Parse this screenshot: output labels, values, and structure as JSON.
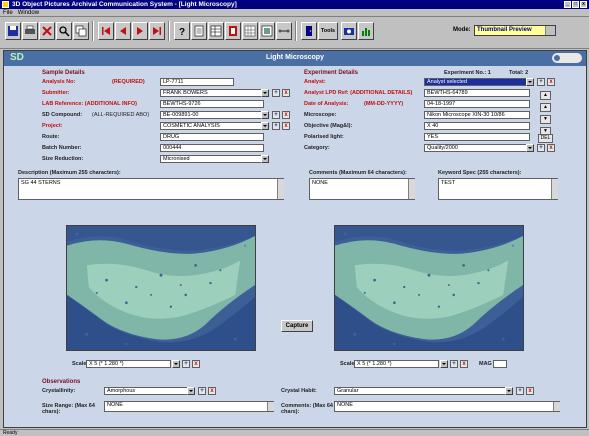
{
  "window": {
    "title": "3D Object Pictures Archival Communication System - [Light Microscopy]",
    "controls": [
      "_",
      "□",
      "x"
    ]
  },
  "menubar": {
    "items": [
      "File",
      "Window"
    ]
  },
  "toolbar": {
    "user_label": "Mode:",
    "mode_value": "Thumbnail Preview",
    "flash_label": "Tools"
  },
  "form": {
    "app_badge": "SD",
    "title": "Light Microscopy",
    "sample": {
      "section": "Sample Details",
      "analysis_no_label": "Analysis No:",
      "analysis_no_hint": "(REQUIRED)",
      "analysis_no_value": "LP-7711",
      "submitter_label": "Submitter:",
      "submitter_value": "FRANK BOWERS",
      "lab_reference_label": "LAB Reference: (ADDITIONAL INFO)",
      "lab_reference_value": "BEWTHS-9726",
      "sd_compound_label": "SD Compound:",
      "sd_compound_hint": "(ALL-REQUIRED ABO)",
      "sd_compound_value": "BE-009891-00",
      "project_label": "Project:",
      "project_value": "COSMETIC ANALYSIS",
      "route_label": "Route:",
      "route_value": "DRUG",
      "batch_label": "Batch Number:",
      "batch_value": "000444",
      "size_label": "Size Reduction:",
      "size_value": "Micronised"
    },
    "experiment": {
      "section": "Experiment Details",
      "number_label": "Experiment No.: 1",
      "total_label": "Total: 2",
      "analyst_label": "Analyst:",
      "analyst_value": "Analyst selected",
      "analysis_label": "Analyst LPD Ref: (ADDITIONAL DETAILS)",
      "analysis_value": "BEWTHS-64789",
      "date_label": "Date of Analysis:",
      "date_hint": "(MM-DD-YYYY)",
      "date_value": "04-18-1997",
      "microscope_label": "Microscope:",
      "microscope_value": "Nikon Microscope XIN-30 10/86",
      "objective_label": "Objective (Mag&l):",
      "objective_value": "X 40",
      "polarised_label": "Polarised light:",
      "polarised_value": "YES",
      "category_label": "Category:",
      "category_value": "Quality/2000"
    },
    "side_buttons": [
      "▲",
      "▲",
      "▼",
      "▼",
      "DEL"
    ],
    "description": {
      "label": "Description (Maximum 255 characters):",
      "value": "SG 44 STERNS"
    },
    "comments": {
      "label": "Comments (Maximum 64 characters):",
      "value": "NONE"
    },
    "keyword": {
      "label": "Keyword Spec (255 characters):",
      "value": "TEST"
    },
    "capture_button": "Capture",
    "left_image": {
      "scale_label": "Scale:",
      "scale_value": "X 5 (* 1.280 *)"
    },
    "right_image": {
      "scale_label": "Scale:",
      "scale_value": "X 5 (* 1.280 *)",
      "mag_label": "MAG"
    },
    "observations": {
      "section": "Observations",
      "crystallinity_label": "Crystallinity:",
      "crystallinity_value": "Amorphous",
      "size_range_label": "Size Range: (Max 64 chars):",
      "size_range_value": "NONE",
      "crystal_habit_label": "Crystal Habit:",
      "crystal_habit_value": "Granular",
      "comments_label": "Comments: (Max 64 chars):",
      "comments_value": "NONE"
    }
  },
  "statusbar": {
    "text": "Ready"
  },
  "colors": {
    "header_blue": "#4a6fa5",
    "form_bg": "#cbd6e8",
    "required_red": "#c01010",
    "title_navy": "#000080"
  }
}
